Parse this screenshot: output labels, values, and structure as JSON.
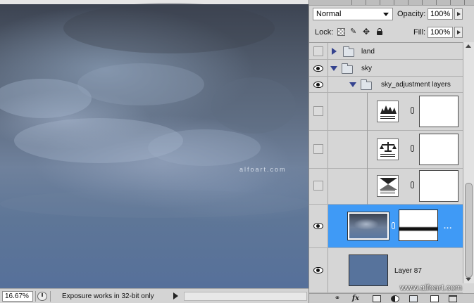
{
  "canvas": {
    "watermark": "alfoart.com"
  },
  "status_bar": {
    "zoom": "16.67%",
    "message": "Exposure works in 32-bit only"
  },
  "layers_panel": {
    "blend_mode": "Normal",
    "opacity_label": "Opacity:",
    "opacity_value": "100%",
    "lock_label": "Lock:",
    "fill_label": "Fill:",
    "fill_value": "100%",
    "layers": [
      {
        "name": "land",
        "type": "group",
        "expanded": false,
        "visible": false
      },
      {
        "name": "sky",
        "type": "group",
        "expanded": true,
        "visible": true
      },
      {
        "name": "sky_adjustment layers",
        "type": "group",
        "expanded": true,
        "visible": true
      },
      {
        "name": "",
        "type": "adjustment",
        "icon": "levels-icon",
        "visible": false
      },
      {
        "name": "",
        "type": "adjustment",
        "icon": "balance-icon",
        "visible": false
      },
      {
        "name": "",
        "type": "adjustment",
        "icon": "gradient-map-icon",
        "visible": false
      },
      {
        "name": "",
        "type": "pixel-with-mask",
        "selected": true,
        "visible": true,
        "extra": "..."
      },
      {
        "name": "Layer 87",
        "type": "fill",
        "color": "#57739c",
        "visible": true
      }
    ],
    "selection_color": "#3f9af6"
  },
  "site_watermark": "www.alfoart.com"
}
